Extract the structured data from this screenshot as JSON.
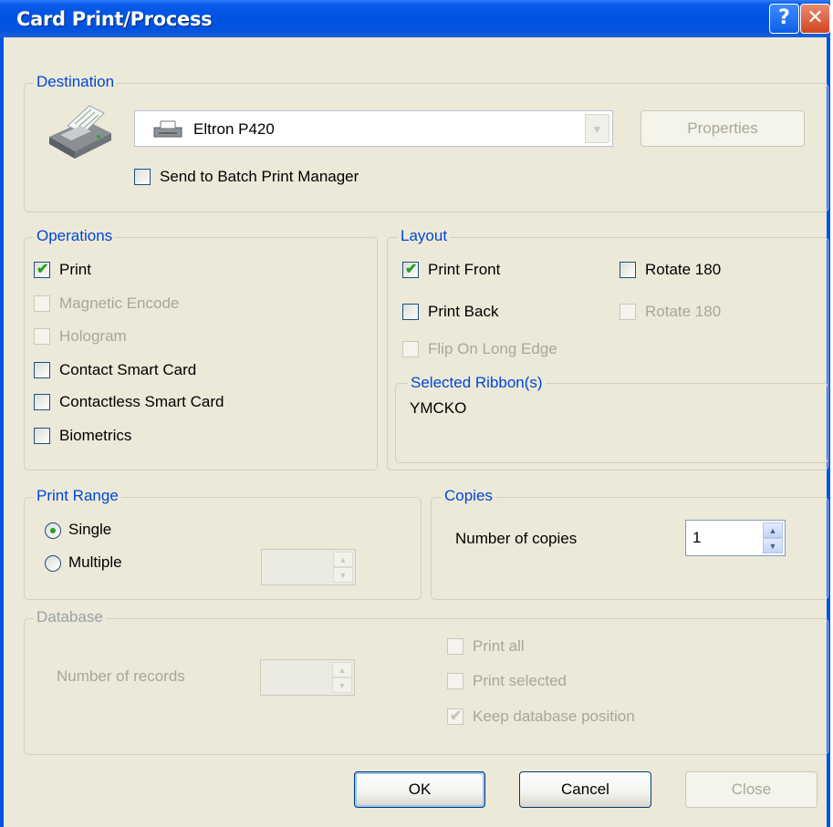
{
  "window": {
    "title": "Card Print/Process",
    "help_label": "?",
    "close_label": "✕"
  },
  "destination": {
    "legend": "Destination",
    "printer_icon": "printer-icon",
    "printer_value": "Eltron P420",
    "properties_label": "Properties",
    "send_batch_label": "Send to Batch Print Manager",
    "send_batch_checked": false
  },
  "operations": {
    "legend": "Operations",
    "items": [
      {
        "label": "Print",
        "checked": true,
        "enabled": true
      },
      {
        "label": "Magnetic Encode",
        "checked": false,
        "enabled": false
      },
      {
        "label": "Hologram",
        "checked": false,
        "enabled": false
      },
      {
        "label": "Contact Smart Card",
        "checked": false,
        "enabled": true
      },
      {
        "label": "Contactless Smart Card",
        "checked": false,
        "enabled": true
      },
      {
        "label": "Biometrics",
        "checked": false,
        "enabled": true
      }
    ]
  },
  "layout": {
    "legend": "Layout",
    "print_front": "Print Front",
    "rotate_front": "Rotate 180",
    "print_back": "Print Back",
    "rotate_back": "Rotate 180",
    "flip_long_edge": "Flip On Long Edge",
    "ribbon_legend": "Selected Ribbon(s)",
    "ribbon_value": "YMCKO"
  },
  "print_range": {
    "legend": "Print Range",
    "single_label": "Single",
    "multiple_label": "Multiple",
    "selected": "Single",
    "range_value": ""
  },
  "copies": {
    "legend": "Copies",
    "label": "Number of copies",
    "value": "1"
  },
  "database": {
    "legend": "Database",
    "records_label": "Number of records",
    "records_value": "",
    "print_all": "Print all",
    "print_selected": "Print selected",
    "keep_position": "Keep database position"
  },
  "buttons": {
    "ok": "OK",
    "cancel": "Cancel",
    "close": "Close"
  },
  "colors": {
    "title_bar": "#0054e3",
    "dialog_bg": "#ece9d8",
    "legend_text": "#0046d5",
    "check_green": "#21a121"
  }
}
